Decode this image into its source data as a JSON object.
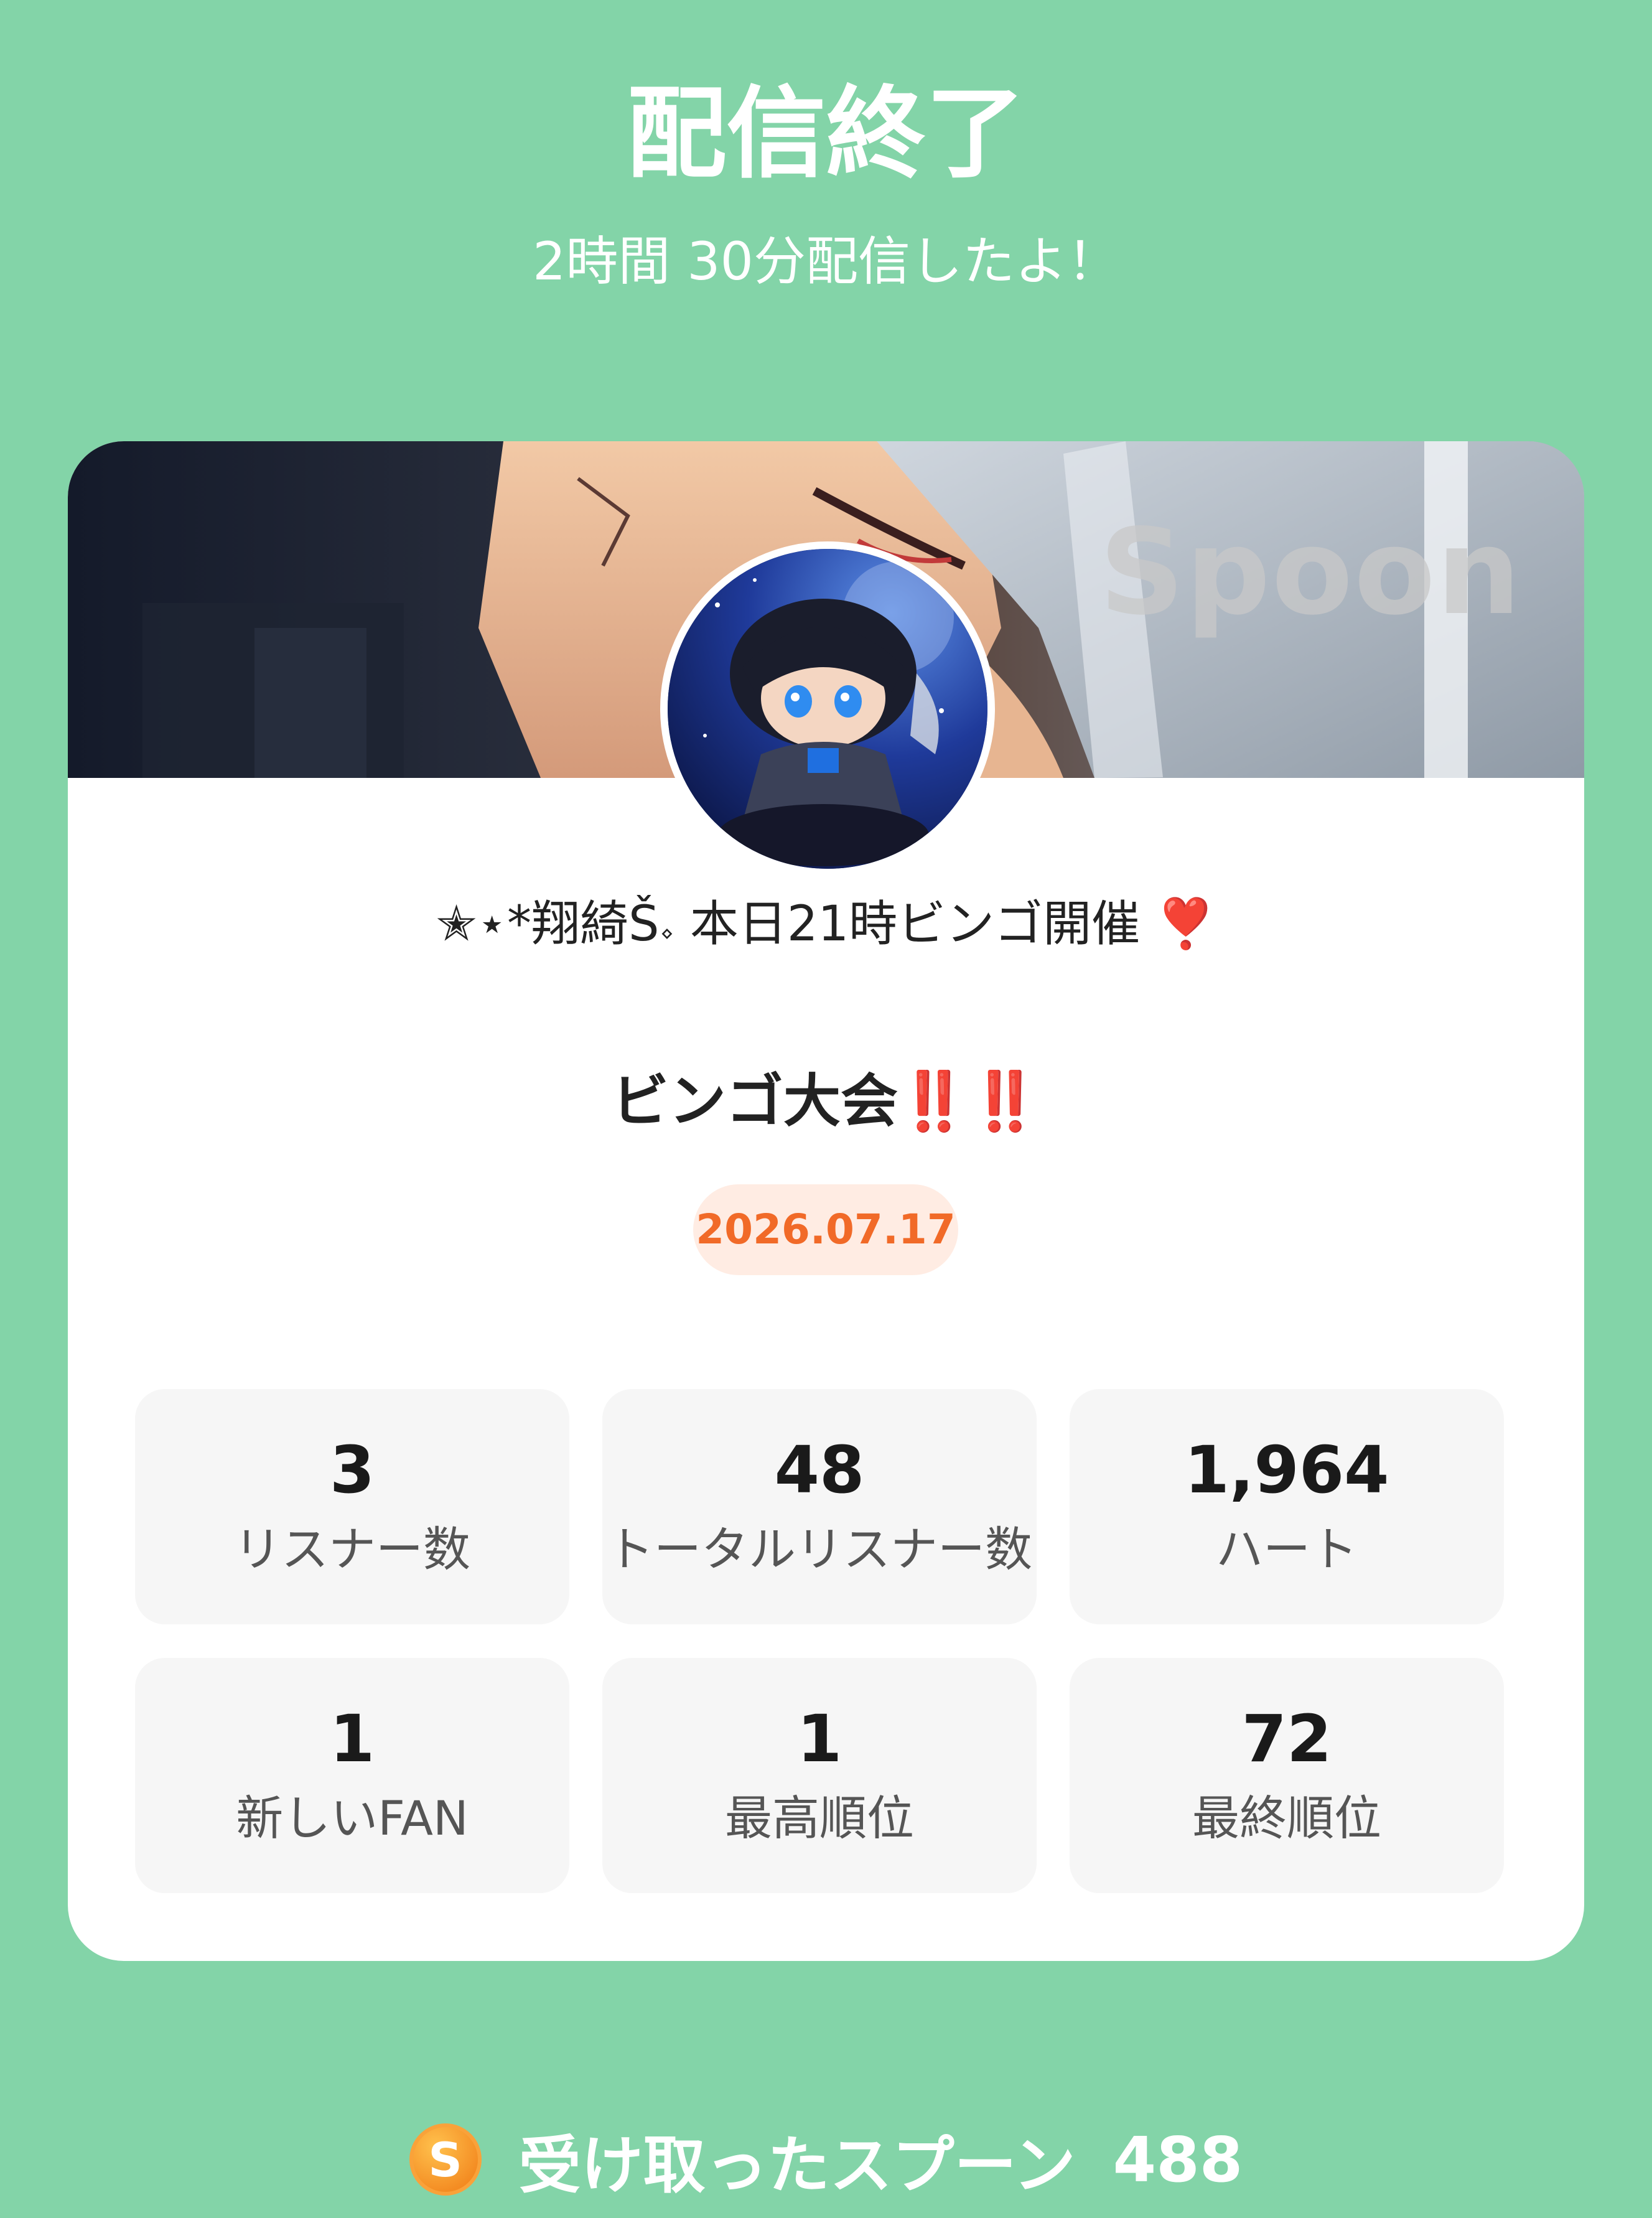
{
  "header": {
    "title": "配信終了",
    "subtitle": "2時間 30分配信したよ！"
  },
  "banner": {
    "watermark": "Spoon"
  },
  "host": {
    "name": "✭⋆*翔綺Š𝆹 本日21時ビンゴ開催",
    "emoji": "❣️"
  },
  "broadcast": {
    "title": "ビンゴ大会",
    "emphasis": "‼️‼️",
    "date": "2026.07.17"
  },
  "stats": [
    {
      "value": "3",
      "label": "リスナー数"
    },
    {
      "value": "48",
      "label": "トータルリスナー数"
    },
    {
      "value": "1,964",
      "label": "ハート"
    },
    {
      "value": "1",
      "label": "新しいFAN"
    },
    {
      "value": "1",
      "label": "最高順位"
    },
    {
      "value": "72",
      "label": "最終順位"
    }
  ],
  "footer": {
    "coin_icon": "spoon-coin-icon",
    "coin_letter": "S",
    "label": "受け取ったスプーン",
    "count": "488"
  },
  "colors": {
    "background": "#83D4A8",
    "date_text": "#F16A28",
    "date_bg": "#FFECE3",
    "stat_bg": "#F6F6F6"
  }
}
